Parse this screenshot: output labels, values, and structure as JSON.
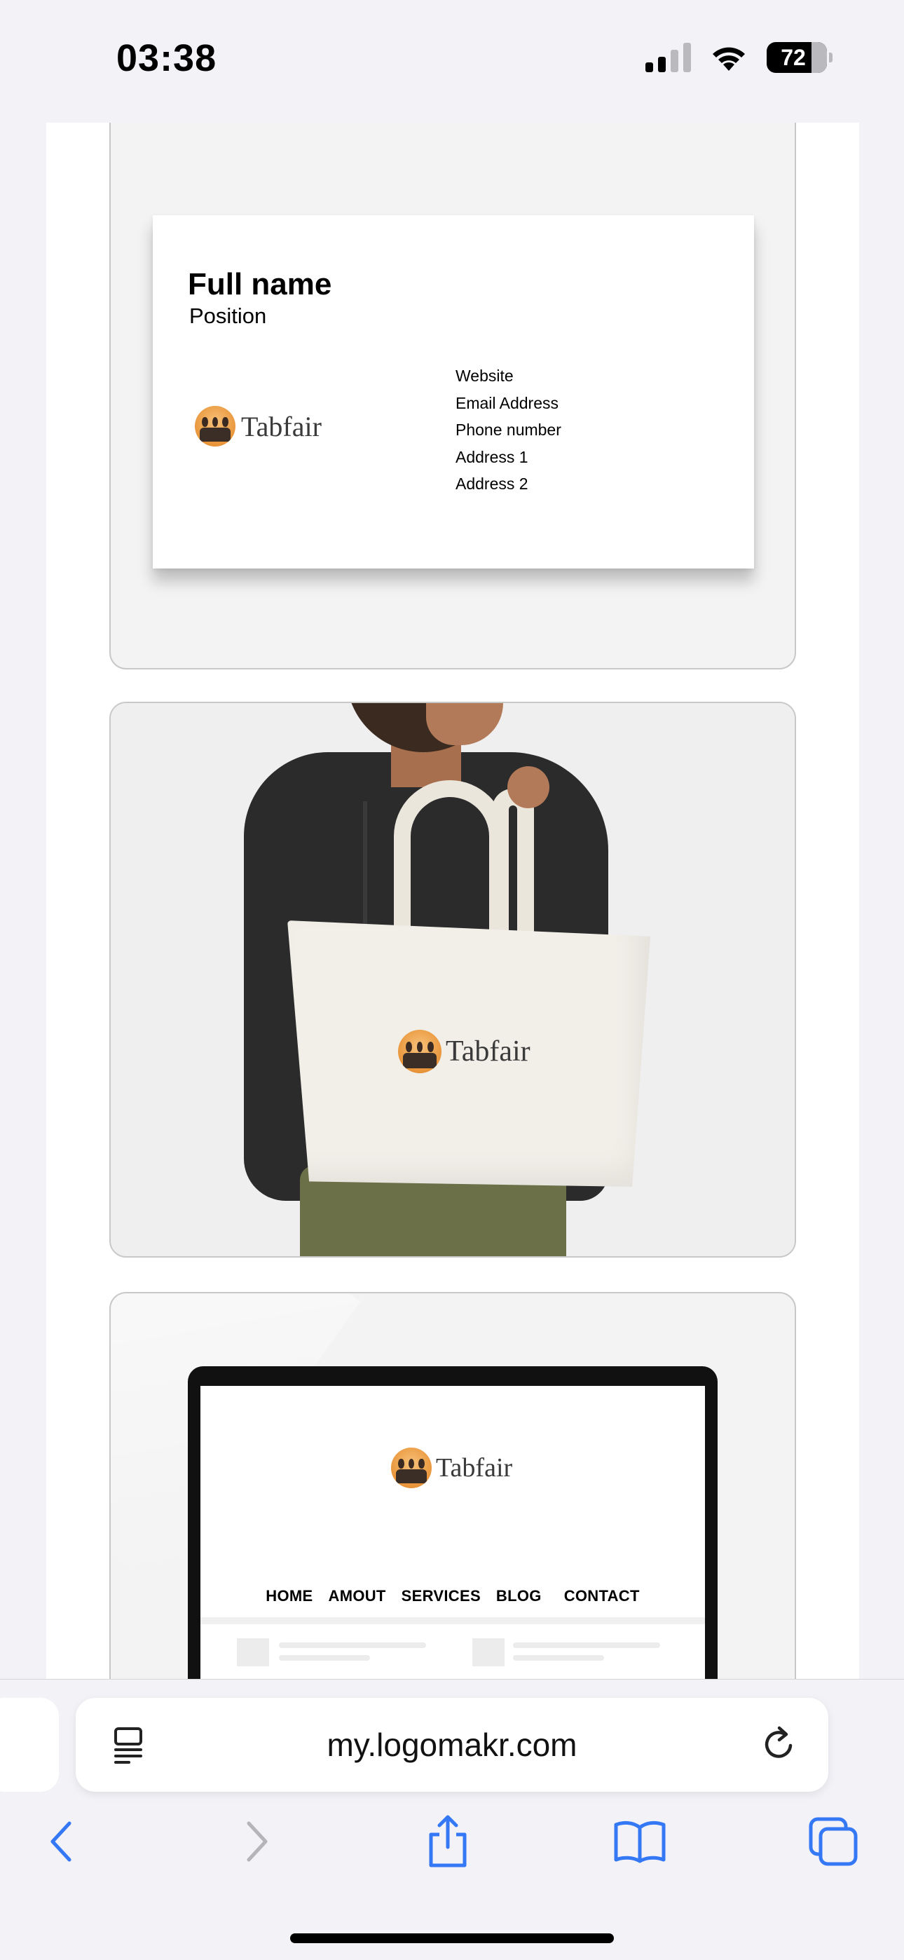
{
  "status_bar": {
    "time": "03:38",
    "battery_level": "72"
  },
  "business_card": {
    "full_name": "Full name",
    "position": "Position",
    "logo_text": "Tabfair",
    "contact_lines": [
      "Website",
      "Email Address",
      "Phone number",
      "Address 1",
      "Address 2"
    ]
  },
  "tote_bag": {
    "logo_text": "Tabfair"
  },
  "laptop_site": {
    "logo_text": "Tabfair",
    "nav_items": [
      "HOME",
      "AMOUT",
      "SERVICES",
      "BLOG",
      "CONTACT"
    ]
  },
  "browser": {
    "url": "my.logomakr.com",
    "accent_color": "#3478f6"
  }
}
